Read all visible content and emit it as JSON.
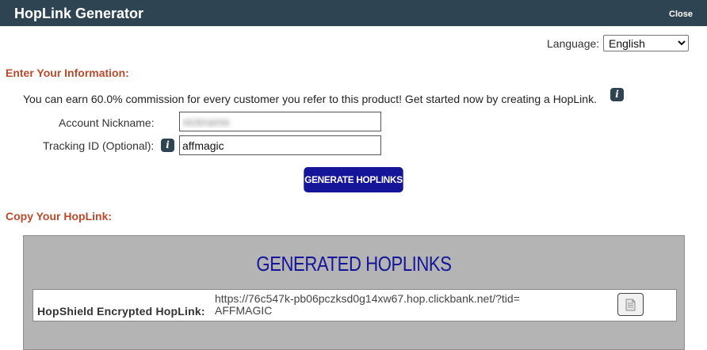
{
  "window": {
    "title": "HopLink Generator",
    "close_label": "Close"
  },
  "language": {
    "label": "Language:",
    "selected": "English",
    "options": [
      "English"
    ]
  },
  "info_section": {
    "heading": "Enter Your Information:",
    "intro_text": "You can earn 60.0% commission for every customer you refer to this product! Get started now by creating a HopLink.",
    "account_nickname": {
      "label": "Account Nickname:",
      "value": "nickname"
    },
    "tracking_id": {
      "label": "Tracking ID (Optional):",
      "value": "affmagic"
    },
    "generate_button": "GENERATE HOPLINKS"
  },
  "copy_section": {
    "heading": "Copy Your HopLink:",
    "panel_title": "GENERATED HOPLINKS",
    "link_label": "HopShield Encrypted HopLink:",
    "link_url": "https://76c547k-pb06pczksd0g14xw67.hop.clickbank.net/?tid=AFFMAGIC"
  },
  "icons": {
    "info": "info-icon",
    "copy": "copy-icon"
  },
  "colors": {
    "titlebar": "#2f4452",
    "heading": "#b94a2c",
    "button": "#15159a",
    "panel": "#b4b4b4"
  }
}
